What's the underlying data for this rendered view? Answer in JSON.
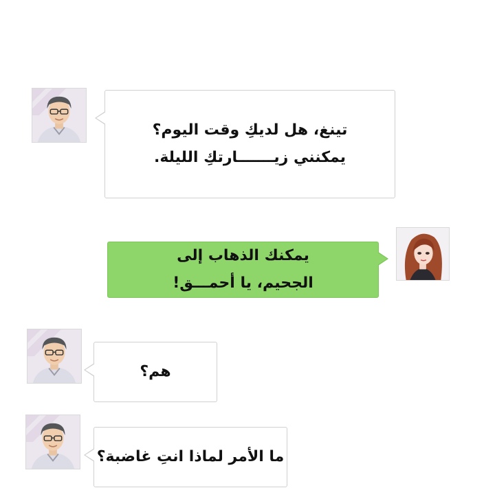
{
  "messages": [
    {
      "sender": "man",
      "side": "left",
      "color": "#ffffff",
      "text": "تينغ، هل لديكِ وقت اليوم؟\nيمكنني زيـــــــارتكِ الليلة."
    },
    {
      "sender": "woman",
      "side": "right",
      "color": "#8fd66a",
      "text": "يمكنك الذهاب إلى\nالجحيم، يا أحمـــق!"
    },
    {
      "sender": "man",
      "side": "left",
      "color": "#ffffff",
      "text": "هم؟"
    },
    {
      "sender": "man",
      "side": "left",
      "color": "#ffffff",
      "text": "ما الأمر لماذا انتِ غاضبة؟"
    }
  ],
  "icons": {
    "man_avatar": "man-glasses-avatar-icon",
    "woman_avatar": "woman-red-hair-avatar-icon"
  }
}
